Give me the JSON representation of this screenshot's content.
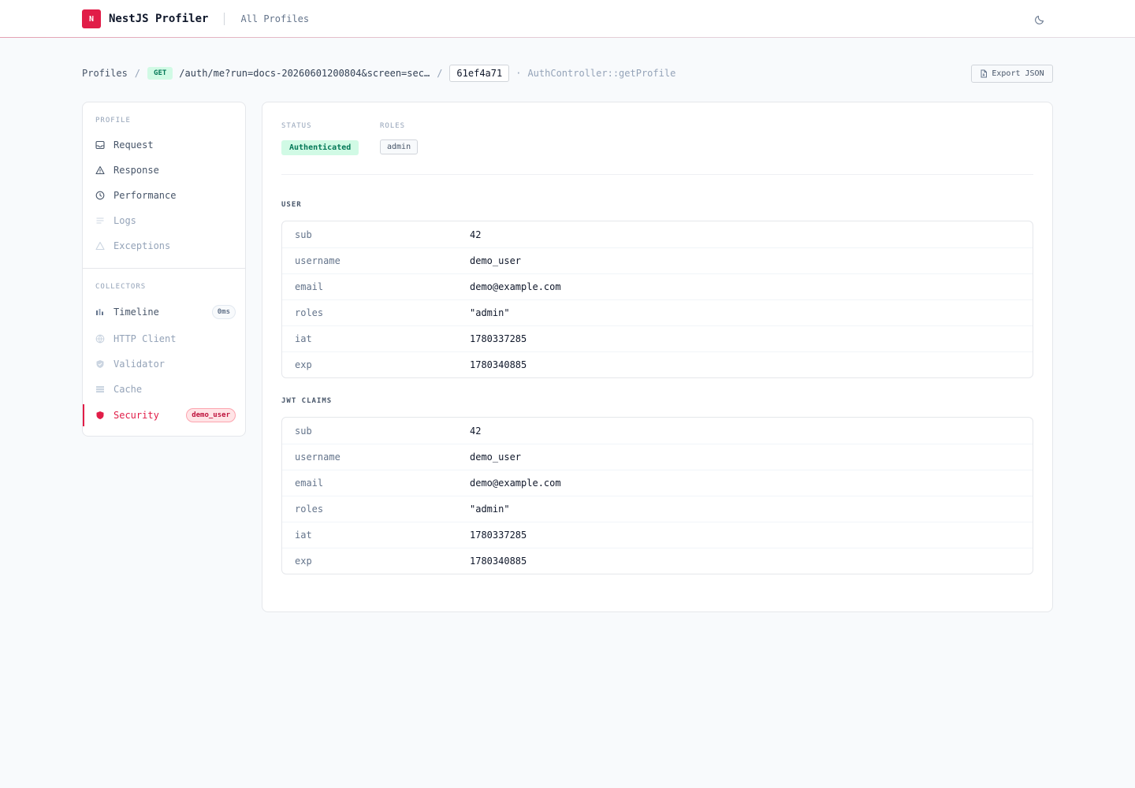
{
  "header": {
    "logo_letter": "N",
    "app_title": "NestJS Profiler",
    "nav_link": "All Profiles",
    "theme_icon": "moon-icon"
  },
  "breadcrumb": {
    "root": "Profiles",
    "separator": "/",
    "method": "GET",
    "path": "/auth/me?run=docs-20260601200804&screen=sec…",
    "token": "61ef4a71",
    "dot": "·",
    "handler": "AuthController::getProfile"
  },
  "export_label": "Export JSON",
  "sidebar": {
    "profile_heading": "PROFILE",
    "profile_items": [
      {
        "label": "Request",
        "icon": "inbox-icon"
      },
      {
        "label": "Response",
        "icon": "triangle-icon"
      },
      {
        "label": "Performance",
        "icon": "clock-icon"
      },
      {
        "label": "Logs",
        "icon": "lines-icon"
      },
      {
        "label": "Exceptions",
        "icon": "warning-icon"
      }
    ],
    "collectors_heading": "COLLECTORS",
    "collector_items": [
      {
        "label": "Timeline",
        "icon": "bars-icon",
        "badge": "0ms"
      },
      {
        "label": "HTTP Client",
        "icon": "globe-icon"
      },
      {
        "label": "Validator",
        "icon": "shield-check-icon"
      },
      {
        "label": "Cache",
        "icon": "database-icon"
      },
      {
        "label": "Security",
        "icon": "shield-icon",
        "badge": "demo_user"
      }
    ]
  },
  "main": {
    "status_label": "STATUS",
    "status_value": "Authenticated",
    "roles_label": "ROLES",
    "roles_value": "admin",
    "user_title": "USER",
    "user_rows": [
      {
        "key": "sub",
        "value": "42"
      },
      {
        "key": "username",
        "value": "demo_user"
      },
      {
        "key": "email",
        "value": "demo@example.com"
      },
      {
        "key": "roles",
        "value": "\"admin\""
      },
      {
        "key": "iat",
        "value": "1780337285"
      },
      {
        "key": "exp",
        "value": "1780340885"
      }
    ],
    "jwt_title": "JWT CLAIMS",
    "jwt_rows": [
      {
        "key": "sub",
        "value": "42"
      },
      {
        "key": "username",
        "value": "demo_user"
      },
      {
        "key": "email",
        "value": "demo@example.com"
      },
      {
        "key": "roles",
        "value": "\"admin\""
      },
      {
        "key": "iat",
        "value": "1780337285"
      },
      {
        "key": "exp",
        "value": "1780340885"
      }
    ]
  },
  "colors": {
    "accent": "#e11d48",
    "success_bg": "#d1fae5",
    "success_text": "#047857"
  }
}
